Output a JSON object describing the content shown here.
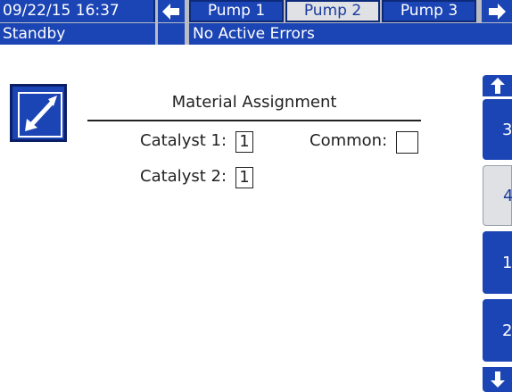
{
  "header": {
    "datetime": "09/22/15 16:37",
    "tabs": [
      {
        "label": "Pump 1",
        "active": false
      },
      {
        "label": "Pump 2",
        "active": true
      },
      {
        "label": "Pump 3",
        "active": false
      }
    ]
  },
  "status": {
    "mode": "Standby",
    "errors": "No Active Errors"
  },
  "main": {
    "title": "Material Assignment",
    "catalyst1_label": "Catalyst 1:",
    "catalyst1_value": "1",
    "common_label": "Common:",
    "common_value": "",
    "catalyst2_label": "Catalyst 2:",
    "catalyst2_value": "1"
  },
  "side_tabs": [
    {
      "label": "3",
      "selected": false
    },
    {
      "label": "4",
      "selected": true
    },
    {
      "label": "1",
      "selected": false
    },
    {
      "label": "2",
      "selected": false
    }
  ],
  "icons": {
    "left": "arrow-left-icon",
    "right": "arrow-right-icon",
    "up": "arrow-up-icon",
    "down": "arrow-down-icon",
    "edit": "edit-icon"
  },
  "colors": {
    "accent_blue": "#1b44b4",
    "selected_tab": "#dfe1e5"
  }
}
